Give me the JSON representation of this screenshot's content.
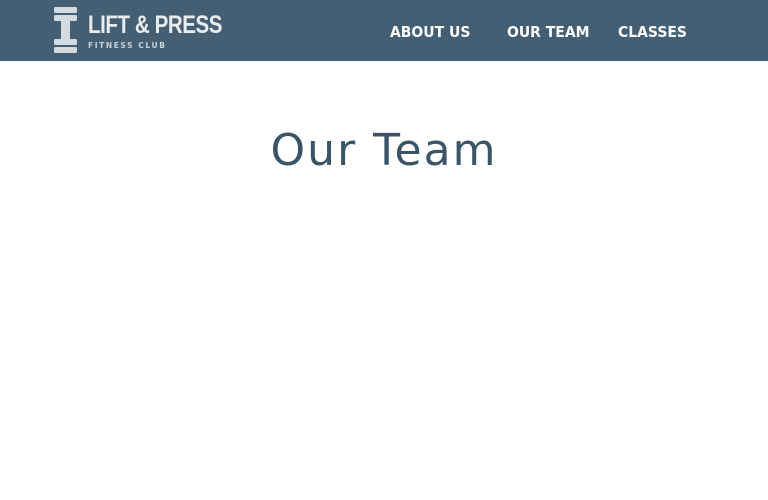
{
  "header": {
    "brand": {
      "name": "LIFT & PRESS",
      "tagline": "FITNESS CLUB",
      "icon": "dumbbell-icon"
    },
    "nav": [
      {
        "label": "ABOUT US"
      },
      {
        "label": "OUR TEAM"
      },
      {
        "label": "CLASSES"
      }
    ]
  },
  "main": {
    "title": "Our Team"
  },
  "colors": {
    "header_bg": "#445f73",
    "title": "#3a5566",
    "nav_text": "#ffffff"
  }
}
